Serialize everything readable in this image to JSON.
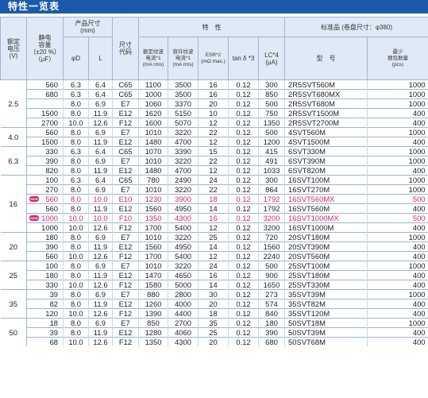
{
  "title": "特性一览表",
  "headers": {
    "rated_voltage": [
      "额定",
      "电压",
      "(V)"
    ],
    "capacitance": [
      "静电",
      "容量",
      "（±20 %）",
      "（μF）"
    ],
    "dimensions": [
      "产品尺寸",
      "(mm)"
    ],
    "phiD": "φD",
    "L": "L",
    "size_code": [
      "尺寸",
      "代码"
    ],
    "characteristics": "特　性",
    "ripple": [
      "额定纹波",
      "电流*1",
      "(mA rms)"
    ],
    "allowable_ripple": [
      "容许纹波",
      "电流*1",
      "(mA rms)"
    ],
    "esr": [
      "ESR*2",
      "(mΩ max.)"
    ],
    "tan": "tan δ *3",
    "lc": [
      "LC*4",
      "(μA)"
    ],
    "standard": "标准品 (卷盘尺寸：φ380)",
    "model": "型　号",
    "pack": [
      "最少",
      "捆包数量",
      "(pcs)"
    ]
  },
  "new_badge": "NEW",
  "groups": [
    {
      "voltage": "2.5",
      "rows": [
        {
          "cap": "560",
          "d": "6.3",
          "l": "6.4",
          "code": "C65",
          "rip": "1100",
          "arip": "3500",
          "esr": "16",
          "tan": "0.12",
          "lc": "300",
          "model": "2R5SVT560M",
          "pcs": "1000",
          "new": false
        },
        {
          "cap": "680",
          "d": "6.3",
          "l": "6.4",
          "code": "C65",
          "rip": "1000",
          "arip": "3500",
          "esr": "16",
          "tan": "0.12",
          "lc": "850",
          "model": "2R5SVT680MX",
          "pcs": "1000",
          "new": false
        },
        {
          "cap": "",
          "d": "8.0",
          "l": "6.9",
          "code": "E7",
          "rip": "1060",
          "arip": "3370",
          "esr": "20",
          "tan": "0.12",
          "lc": "500",
          "model": "2R5SVT680M",
          "pcs": "1000",
          "new": false
        },
        {
          "cap": "1500",
          "d": "8.0",
          "l": "11.9",
          "code": "E12",
          "rip": "1620",
          "arip": "5150",
          "esr": "10",
          "tan": "0.12",
          "lc": "750",
          "model": "2R5SVT1500M",
          "pcs": "400",
          "new": false
        },
        {
          "cap": "2700",
          "d": "10.0",
          "l": "12.6",
          "code": "F12",
          "rip": "1600",
          "arip": "5070",
          "esr": "12",
          "tan": "0.12",
          "lc": "1350",
          "model": "2R5SVT2700M",
          "pcs": "400",
          "new": false
        }
      ]
    },
    {
      "voltage": "4.0",
      "rows": [
        {
          "cap": "560",
          "d": "8.0",
          "l": "6.9",
          "code": "E7",
          "rip": "1010",
          "arip": "3220",
          "esr": "22",
          "tan": "0.12",
          "lc": "500",
          "model": "4SVT560M",
          "pcs": "1000",
          "new": false
        },
        {
          "cap": "1500",
          "d": "8.0",
          "l": "11.9",
          "code": "E12",
          "rip": "1480",
          "arip": "4700",
          "esr": "12",
          "tan": "0.12",
          "lc": "1200",
          "model": "4SVT1500M",
          "pcs": "400",
          "new": false
        }
      ]
    },
    {
      "voltage": "6.3",
      "rows": [
        {
          "cap": "330",
          "d": "6.3",
          "l": "6.4",
          "code": "C65",
          "rip": "1070",
          "arip": "3390",
          "esr": "15",
          "tan": "0.12",
          "lc": "415",
          "model": "6SVT330M",
          "pcs": "1000",
          "new": false
        },
        {
          "cap": "390",
          "d": "8.0",
          "l": "6.9",
          "code": "E7",
          "rip": "1010",
          "arip": "3220",
          "esr": "22",
          "tan": "0.12",
          "lc": "491",
          "model": "6SVT390M",
          "pcs": "1000",
          "new": false
        },
        {
          "cap": "820",
          "d": "8.0",
          "l": "11.9",
          "code": "E12",
          "rip": "1480",
          "arip": "4700",
          "esr": "12",
          "tan": "0.12",
          "lc": "1033",
          "model": "6SVT820M",
          "pcs": "400",
          "new": false
        }
      ]
    },
    {
      "voltage": "16",
      "rows": [
        {
          "cap": "100",
          "d": "6.3",
          "l": "6.4",
          "code": "C65",
          "rip": "780",
          "arip": "2490",
          "esr": "24",
          "tan": "0.12",
          "lc": "300",
          "model": "16SVT100M",
          "pcs": "1000",
          "new": false
        },
        {
          "cap": "270",
          "d": "8.0",
          "l": "6.9",
          "code": "E7",
          "rip": "1010",
          "arip": "3220",
          "esr": "22",
          "tan": "0.12",
          "lc": "864",
          "model": "16SVT270M",
          "pcs": "1000",
          "new": false
        },
        {
          "cap": "560",
          "d": "8.0",
          "l": "10.0",
          "code": "E10",
          "rip": "1230",
          "arip": "3900",
          "esr": "18",
          "tan": "0.12",
          "lc": "1792",
          "model": "16SVT560MX",
          "pcs": "500",
          "new": true
        },
        {
          "cap": "560",
          "d": "8.0",
          "l": "11.9",
          "code": "E12",
          "rip": "1560",
          "arip": "4950",
          "esr": "14",
          "tan": "0.12",
          "lc": "1792",
          "model": "16SVT560M",
          "pcs": "400",
          "new": false
        },
        {
          "cap": "1000",
          "d": "10.0",
          "l": "10.0",
          "code": "F10",
          "rip": "1350",
          "arip": "4300",
          "esr": "16",
          "tan": "0.12",
          "lc": "3200",
          "model": "16SVT1000MX",
          "pcs": "500",
          "new": true
        },
        {
          "cap": "1000",
          "d": "10.0",
          "l": "12.6",
          "code": "F12",
          "rip": "1700",
          "arip": "5400",
          "esr": "12",
          "tan": "0.12",
          "lc": "3200",
          "model": "16SVT1000M",
          "pcs": "400",
          "new": false
        }
      ]
    },
    {
      "voltage": "20",
      "rows": [
        {
          "cap": "180",
          "d": "8.0",
          "l": "6.9",
          "code": "E7",
          "rip": "1010",
          "arip": "3220",
          "esr": "25",
          "tan": "0.12",
          "lc": "720",
          "model": "20SVT180M",
          "pcs": "1000",
          "new": false
        },
        {
          "cap": "390",
          "d": "8.0",
          "l": "11.9",
          "code": "E12",
          "rip": "1560",
          "arip": "4950",
          "esr": "14",
          "tan": "0.12",
          "lc": "1560",
          "model": "20SVT390M",
          "pcs": "400",
          "new": false
        },
        {
          "cap": "560",
          "d": "10.0",
          "l": "12.6",
          "code": "F12",
          "rip": "1700",
          "arip": "5400",
          "esr": "12",
          "tan": "0.12",
          "lc": "2240",
          "model": "20SVT560M",
          "pcs": "400",
          "new": false
        }
      ]
    },
    {
      "voltage": "25",
      "rows": [
        {
          "cap": "100",
          "d": "8.0",
          "l": "6.9",
          "code": "E7",
          "rip": "1010",
          "arip": "3220",
          "esr": "24",
          "tan": "0.12",
          "lc": "500",
          "model": "25SVT100M",
          "pcs": "1000",
          "new": false
        },
        {
          "cap": "180",
          "d": "8.0",
          "l": "11.9",
          "code": "E12",
          "rip": "1470",
          "arip": "4650",
          "esr": "16",
          "tan": "0.12",
          "lc": "900",
          "model": "25SVT180M",
          "pcs": "400",
          "new": false
        },
        {
          "cap": "330",
          "d": "10.0",
          "l": "12.6",
          "code": "F12",
          "rip": "1580",
          "arip": "5000",
          "esr": "14",
          "tan": "0.12",
          "lc": "1650",
          "model": "25SVT330M",
          "pcs": "400",
          "new": false
        }
      ]
    },
    {
      "voltage": "35",
      "rows": [
        {
          "cap": "39",
          "d": "8.0",
          "l": "6.9",
          "code": "E7",
          "rip": "880",
          "arip": "2800",
          "esr": "30",
          "tan": "0.12",
          "lc": "273",
          "model": "35SVT39M",
          "pcs": "1000",
          "new": false
        },
        {
          "cap": "82",
          "d": "8.0",
          "l": "11.9",
          "code": "E12",
          "rip": "1260",
          "arip": "4000",
          "esr": "20",
          "tan": "0.12",
          "lc": "574",
          "model": "35SVT82M",
          "pcs": "400",
          "new": false
        },
        {
          "cap": "120",
          "d": "10.0",
          "l": "12.6",
          "code": "F12",
          "rip": "1390",
          "arip": "4400",
          "esr": "18",
          "tan": "0.12",
          "lc": "840",
          "model": "35SVT120M",
          "pcs": "400",
          "new": false
        }
      ]
    },
    {
      "voltage": "50",
      "rows": [
        {
          "cap": "18",
          "d": "8.0",
          "l": "6.9",
          "code": "E7",
          "rip": "850",
          "arip": "2700",
          "esr": "35",
          "tan": "0.12",
          "lc": "180",
          "model": "50SVT18M",
          "pcs": "1000",
          "new": false
        },
        {
          "cap": "39",
          "d": "8.0",
          "l": "11.9",
          "code": "E12",
          "rip": "1280",
          "arip": "4060",
          "esr": "25",
          "tan": "0.12",
          "lc": "390",
          "model": "50SVT39M",
          "pcs": "400",
          "new": false
        },
        {
          "cap": "68",
          "d": "10.0",
          "l": "12.6",
          "code": "F12",
          "rip": "1350",
          "arip": "4300",
          "esr": "20",
          "tan": "0.12",
          "lc": "680",
          "model": "50SVT68M",
          "pcs": "400",
          "new": false
        }
      ]
    }
  ]
}
